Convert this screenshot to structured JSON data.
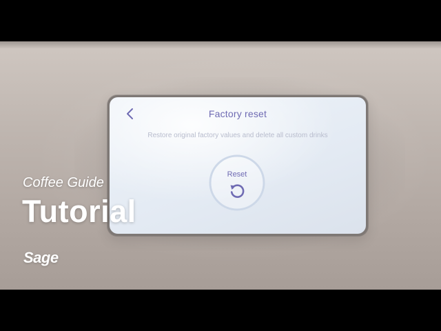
{
  "device_screen": {
    "title": "Factory reset",
    "description": "Restore original factory values and delete all custom drinks",
    "back_icon": "chevron-left-icon",
    "reset_button": {
      "label": "Reset",
      "icon": "reset-arrow-icon"
    },
    "accent_color": "#6f6bb3"
  },
  "video_overlay": {
    "subtitle": "Coffee Guide",
    "title": "Tutorial",
    "brand": "Sage"
  }
}
